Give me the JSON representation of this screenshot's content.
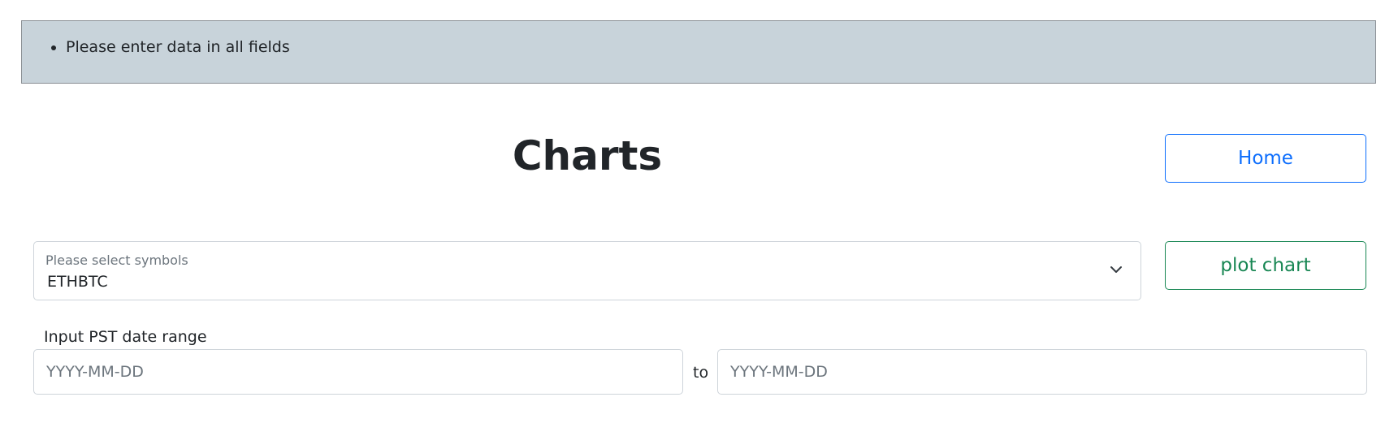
{
  "alert": {
    "messages": [
      "Please enter data in all fields"
    ]
  },
  "page": {
    "title": "Charts"
  },
  "nav": {
    "home_label": "Home"
  },
  "symbols": {
    "label": "Please select symbols",
    "selected": "ETHBTC"
  },
  "actions": {
    "plot_label": "plot chart"
  },
  "date_range": {
    "label": "Input PST date range",
    "separator": "to",
    "start_placeholder": "YYYY-MM-DD",
    "end_placeholder": "YYYY-MM-DD",
    "start_value": "",
    "end_value": ""
  },
  "colors": {
    "alert_bg": "#c8d3da",
    "primary": "#0d6efd",
    "success": "#198754"
  }
}
